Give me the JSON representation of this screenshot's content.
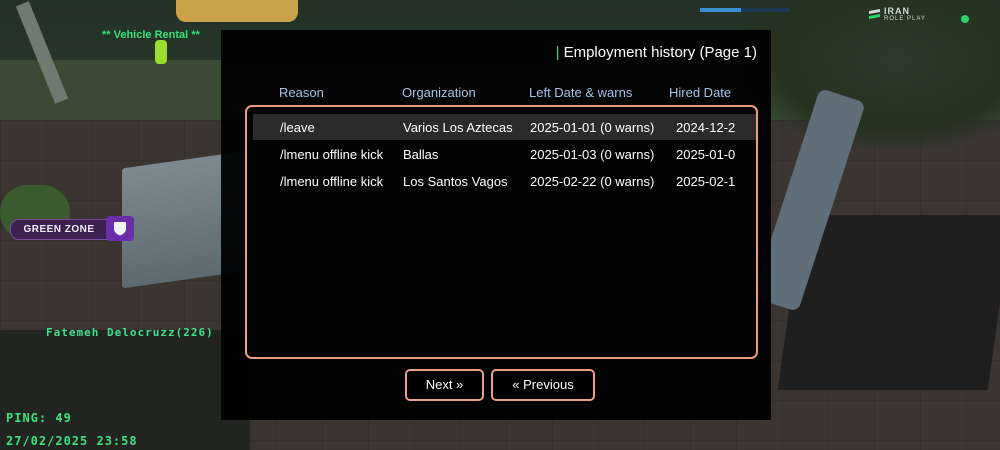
{
  "hud": {
    "vehicle_rental_label": "**  Vehicle Rental **",
    "player_name": "Fatemeh Delocruzz(226)",
    "ping": "PING: 49",
    "datetime": "27/02/2025 23:58",
    "green_zone_label": "GREEN ZONE",
    "progress": 0.45,
    "logo_line1": "IRAN",
    "logo_line2": "ROLE PLAY"
  },
  "dialog": {
    "title": "Employment history (Page 1)",
    "columns": [
      "Reason",
      "Organization",
      "Left Date & warns",
      "Hired Date"
    ],
    "rows": [
      {
        "reason": "/leave",
        "organization": "Varios Los Aztecas",
        "left": "2025-01-01 (0 warns)",
        "hired": "2024-12-2"
      },
      {
        "reason": "/lmenu offline kick",
        "organization": "Ballas",
        "left": "2025-01-03 (0 warns)",
        "hired": "2025-01-0"
      },
      {
        "reason": "/lmenu offline kick",
        "organization": "Los Santos Vagos",
        "left": "2025-02-22 (0 warns)",
        "hired": "2025-02-1"
      }
    ],
    "next_button": "Next »",
    "previous_button": "« Previous"
  },
  "colors": {
    "accent_border": "#e8a07f",
    "header_text": "#a8c3e6",
    "hud_green": "#3fe07e"
  },
  "icons": {
    "green_zone": "shield-icon",
    "logo": "iran-roleplay-logo"
  }
}
